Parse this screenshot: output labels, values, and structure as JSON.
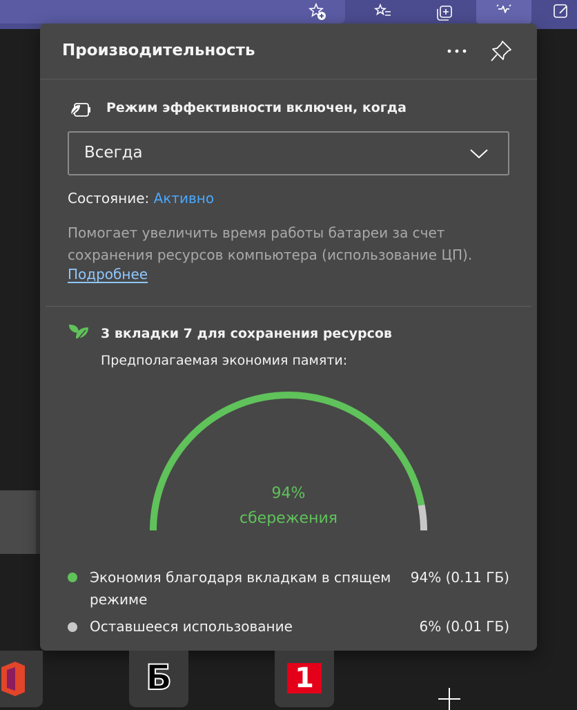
{
  "panel": {
    "title": "Производительность"
  },
  "efficiency": {
    "heading": "Режим эффективности включен, когда",
    "dropdown_value": "Всегда",
    "status_label": "Состояние:",
    "status_value": "Активно",
    "description": "Помогает увеличить время работы батареи за счет сохранения ресурсов компьютера (использование ЦП).",
    "learn_more": "Подробнее"
  },
  "sleeping": {
    "heading": "3 вкладки 7 для сохранения ресурсов",
    "memory_label": "Предполагаемая экономия памяти:",
    "gauge_percent": "94%",
    "gauge_label": "сбережения",
    "gauge_fraction": 0.94,
    "legend": [
      {
        "label": "Экономия благодаря вкладкам в спящем режиме",
        "value": "94% (0.11 ГБ)",
        "color": "#5fc25a"
      },
      {
        "label": "Оставшееся использование",
        "value": "6% (0.01 ГБ)",
        "color": "#c8c8c8"
      }
    ]
  },
  "taskbar": {
    "second_glyph": "Б",
    "third_glyph": "1"
  },
  "colors": {
    "accent_green": "#5fc25a",
    "link_blue": "#4aa8ff",
    "toolbar": "#4b4c8f"
  }
}
